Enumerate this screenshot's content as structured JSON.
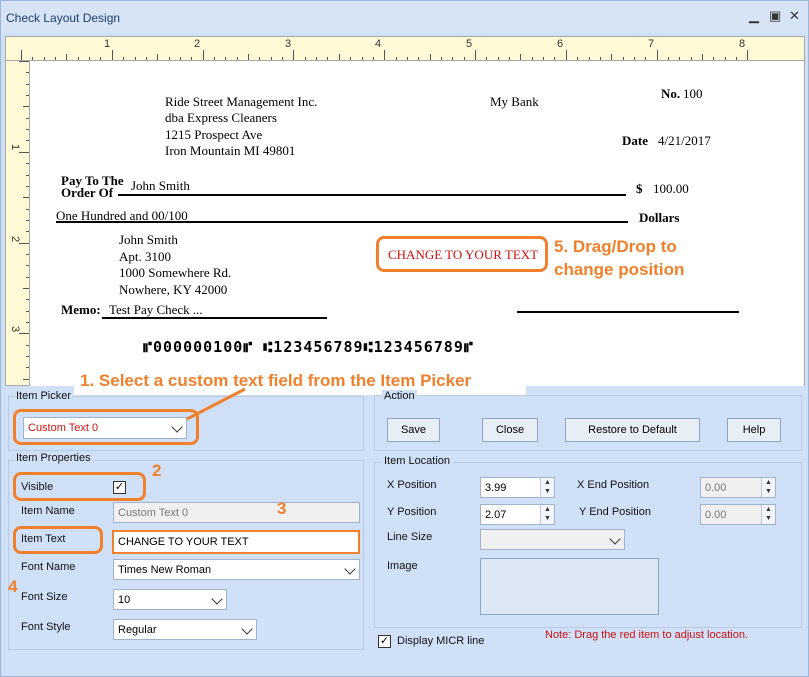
{
  "window": {
    "title": "Check Layout Design"
  },
  "ruler": {
    "h_numbers": [
      "1",
      "2",
      "3",
      "4",
      "5",
      "6",
      "7",
      "8"
    ],
    "v_numbers": [
      "1",
      "2",
      "3"
    ]
  },
  "check": {
    "company_lines": [
      "Ride Street Management Inc.",
      "dba Express Cleaners",
      "1215 Prospect Ave",
      "Iron Mountain MI 49801"
    ],
    "bank": "My Bank",
    "no_label": "No.",
    "no_value": "100",
    "date_label": "Date",
    "date_value": "4/21/2017",
    "pay_to_label_1": "Pay To The",
    "pay_to_label_2": "Order Of",
    "payee": "John Smith",
    "dollar_sign": "$",
    "amount": "100.00",
    "amount_words": "One Hundred  and 00/100",
    "dollars_label": "Dollars",
    "address_lines": [
      "John Smith",
      "Apt. 3100",
      "1000 Somewhere Rd.",
      "Nowhere, KY 42000"
    ],
    "custom_text": "CHANGE TO YOUR TEXT",
    "memo_label": "Memo:",
    "memo_value": "Test Pay Check ...",
    "micr_line": "⑈000000100⑈ ⑆123456789⑆123456789⑈"
  },
  "callouts": {
    "c1": "1. Select a custom text field from the Item Picker",
    "c2": "2",
    "c3": "3",
    "c4": "4",
    "c5_line1": "5. Drag/Drop to",
    "c5_line2": "change position"
  },
  "item_picker": {
    "label": "Item Picker",
    "selected": "Custom Text 0"
  },
  "item_properties": {
    "label": "Item Properties",
    "visible_label": "Visible",
    "visible_checked": true,
    "item_name_label": "Item Name",
    "item_name_value": "Custom Text 0",
    "item_text_label": "Item Text",
    "item_text_value": "CHANGE TO YOUR TEXT",
    "font_name_label": "Font Name",
    "font_name_value": "Times New Roman",
    "font_size_label": "Font Size",
    "font_size_value": "10",
    "font_style_label": "Font Style",
    "font_style_value": "Regular"
  },
  "action": {
    "label": "Action",
    "save": "Save",
    "close": "Close",
    "restore": "Restore to Default",
    "help": "Help"
  },
  "item_location": {
    "label": "Item Location",
    "x_label": "X Position",
    "x_value": "3.99",
    "y_label": "Y Position",
    "y_value": "2.07",
    "x_end_label": "X End Position",
    "x_end_value": "0.00",
    "y_end_label": "Y End Position",
    "y_end_value": "0.00",
    "line_size_label": "Line Size",
    "image_label": "Image"
  },
  "micr_toggle": {
    "label": "Display MICR line",
    "checked": true
  },
  "note": "Note:  Drag the red item to adjust location.",
  "colors": {
    "accent_orange": "#f0802b",
    "note_red": "#cc1111",
    "panel_bg": "#cfe0f7"
  }
}
